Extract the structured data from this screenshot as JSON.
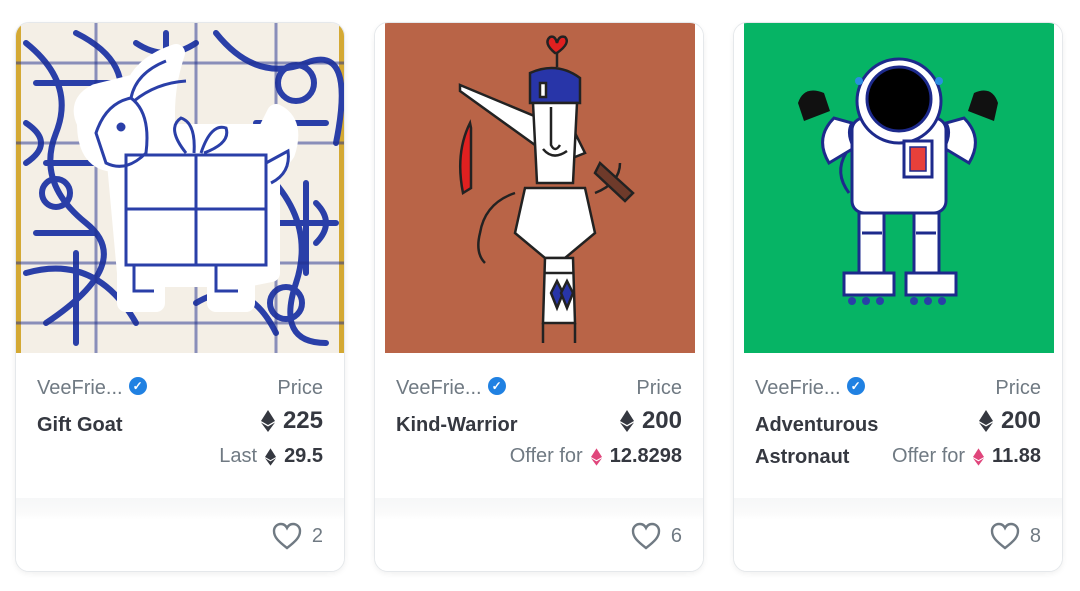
{
  "cards": [
    {
      "collection": "VeeFrie...",
      "name": "Gift Goat",
      "price_label": "Price",
      "price": "225",
      "sub_label": "Last",
      "sub_value": "29.5",
      "sub_currency_color": "#353840",
      "likes": "2",
      "art": "goat-artwork",
      "bg_color": "#2a3fa8"
    },
    {
      "collection": "VeeFrie...",
      "name": "Kind-Warrior",
      "price_label": "Price",
      "price": "200",
      "sub_label": "Offer for",
      "sub_value": "12.8298",
      "sub_currency_color": "#e0457b",
      "likes": "6",
      "art": "warrior-artwork",
      "bg_color": "#b96447"
    },
    {
      "collection": "VeeFrie...",
      "name": "Adventurous Astronaut",
      "price_label": "Price",
      "price": "200",
      "sub_label": "Offer for",
      "sub_value": "11.88",
      "sub_currency_color": "#e0457b",
      "likes": "8",
      "art": "astronaut-artwork",
      "bg_color": "#06b465"
    }
  ],
  "colors": {
    "verified": "#2081e2",
    "muted_text": "#707a83",
    "text": "#353840"
  }
}
